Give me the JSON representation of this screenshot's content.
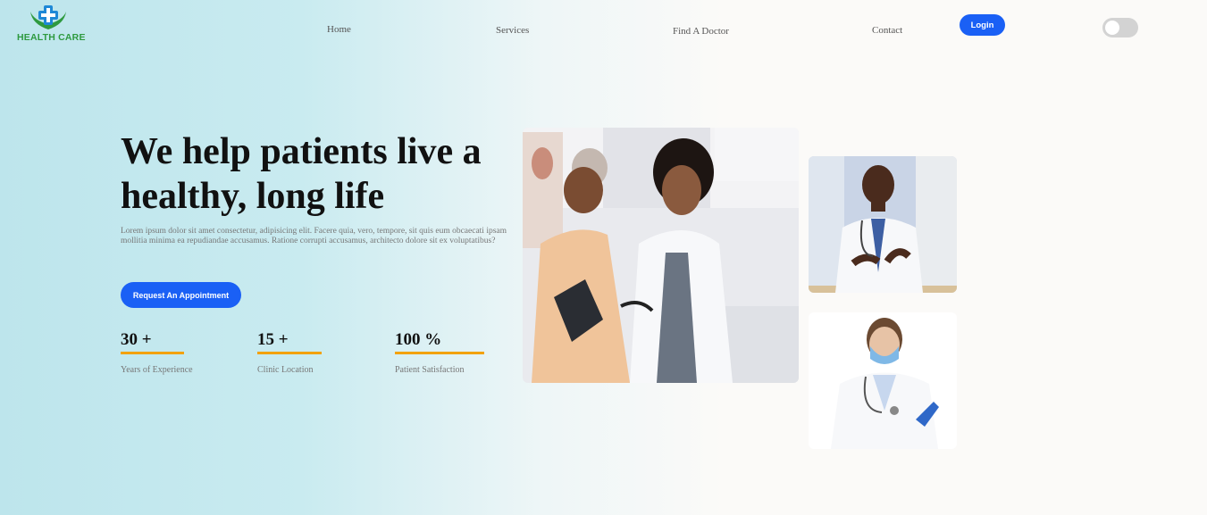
{
  "brand": {
    "name": "HEALTH CARE",
    "logo_icon": "medical-cross-hands-icon",
    "color": "#2e9a3f"
  },
  "nav": {
    "items": [
      {
        "label": "Home"
      },
      {
        "label": "Services"
      },
      {
        "label": "Find A Doctor"
      },
      {
        "label": "Contact"
      }
    ],
    "login_label": "Login",
    "theme_toggle": {
      "icon": "toggle-switch-icon",
      "state": "off"
    }
  },
  "hero": {
    "title": "We help patients live a healthy, long life",
    "description": "Lorem ipsum dolor sit amet consectetur, adipisicing elit. Facere quia, vero, tempore, sit quis eum obcaecati ipsam mollitia minima ea repudiandae accusamus. Ratione corrupti accusamus, architecto dolore sit ex voluptatibus?",
    "cta_label": "Request An Appointment"
  },
  "stats": [
    {
      "value": "30 +",
      "label": "Years of Experience"
    },
    {
      "value": "15 +",
      "label": "Clinic Location"
    },
    {
      "value": "100 %",
      "label": "Patient Satisfaction"
    }
  ],
  "colors": {
    "accent": "#1a60f5",
    "stat_underline": "#f2a20c"
  }
}
